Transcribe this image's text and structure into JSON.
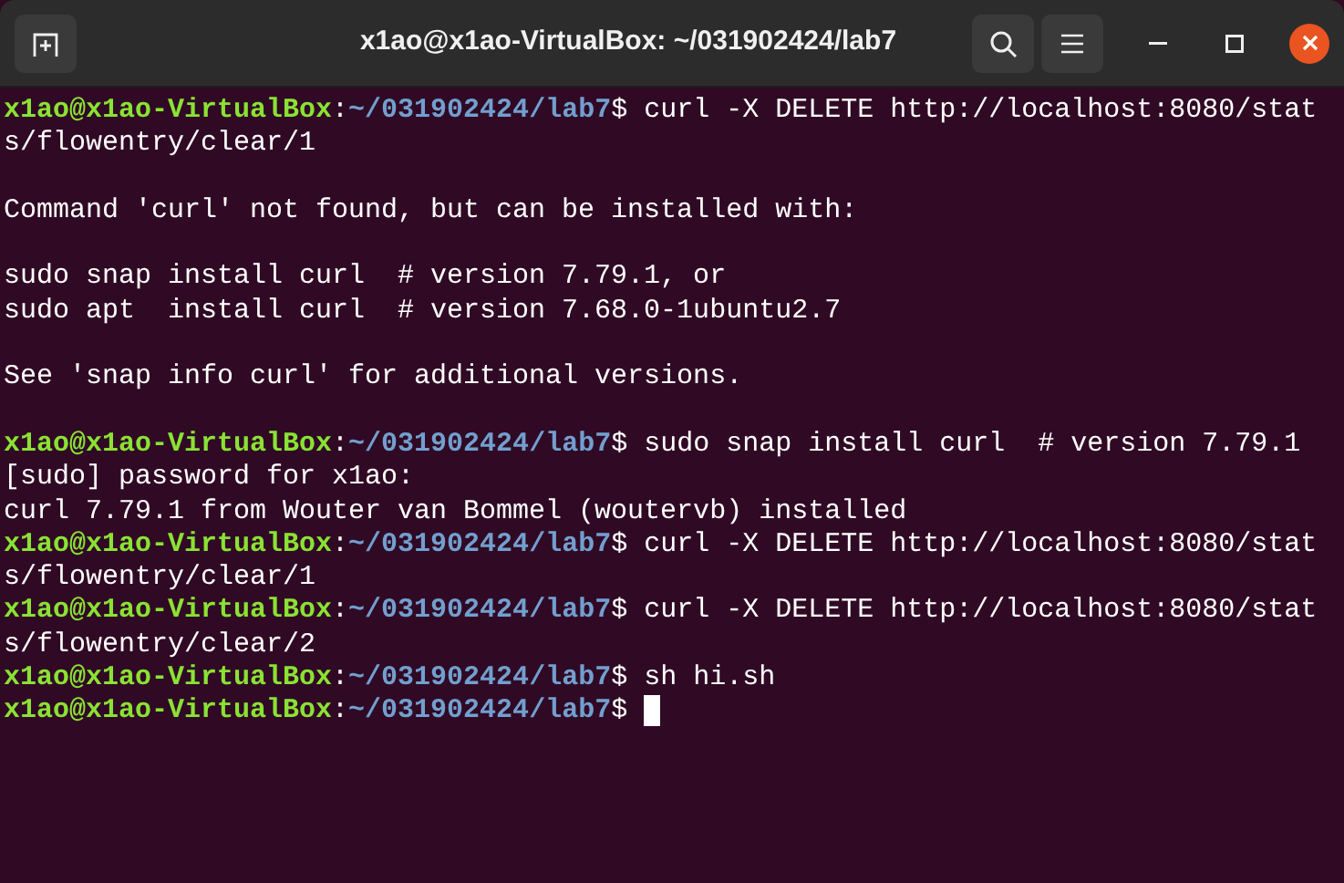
{
  "window": {
    "title": "x1ao@x1ao-VirtualBox: ~/031902424/lab7"
  },
  "terminal": {
    "lines": [
      {
        "kind": "prompt",
        "user_host": "x1ao@x1ao-VirtualBox",
        "separator": ":",
        "path": "~/031902424/lab7",
        "symbol": "$",
        "command": "curl -X DELETE http://localhost:8080/stat",
        "cursor": false
      },
      {
        "kind": "output",
        "text": "s/flowentry/clear/1"
      },
      {
        "kind": "blank"
      },
      {
        "kind": "output",
        "text": "Command 'curl' not found, but can be installed with:"
      },
      {
        "kind": "blank"
      },
      {
        "kind": "output",
        "text": "sudo snap install curl  # version 7.79.1, or"
      },
      {
        "kind": "output",
        "text": "sudo apt  install curl  # version 7.68.0-1ubuntu2.7"
      },
      {
        "kind": "blank"
      },
      {
        "kind": "output",
        "text": "See 'snap info curl' for additional versions."
      },
      {
        "kind": "blank"
      },
      {
        "kind": "prompt",
        "user_host": "x1ao@x1ao-VirtualBox",
        "separator": ":",
        "path": "~/031902424/lab7",
        "symbol": "$",
        "command": "sudo snap install curl  # version 7.79.1",
        "cursor": false
      },
      {
        "kind": "output",
        "text": "[sudo] password for x1ao:"
      },
      {
        "kind": "output",
        "text": "curl 7.79.1 from Wouter van Bommel (woutervb) installed"
      },
      {
        "kind": "prompt",
        "user_host": "x1ao@x1ao-VirtualBox",
        "separator": ":",
        "path": "~/031902424/lab7",
        "symbol": "$",
        "command": "curl -X DELETE http://localhost:8080/stat",
        "cursor": false
      },
      {
        "kind": "output",
        "text": "s/flowentry/clear/1"
      },
      {
        "kind": "prompt",
        "user_host": "x1ao@x1ao-VirtualBox",
        "separator": ":",
        "path": "~/031902424/lab7",
        "symbol": "$",
        "command": "curl -X DELETE http://localhost:8080/stat",
        "cursor": false
      },
      {
        "kind": "output",
        "text": "s/flowentry/clear/2"
      },
      {
        "kind": "prompt",
        "user_host": "x1ao@x1ao-VirtualBox",
        "separator": ":",
        "path": "~/031902424/lab7",
        "symbol": "$",
        "command": "sh hi.sh",
        "cursor": false
      },
      {
        "kind": "prompt",
        "user_host": "x1ao@x1ao-VirtualBox",
        "separator": ":",
        "path": "~/031902424/lab7",
        "symbol": "$",
        "cursor": true
      }
    ]
  }
}
